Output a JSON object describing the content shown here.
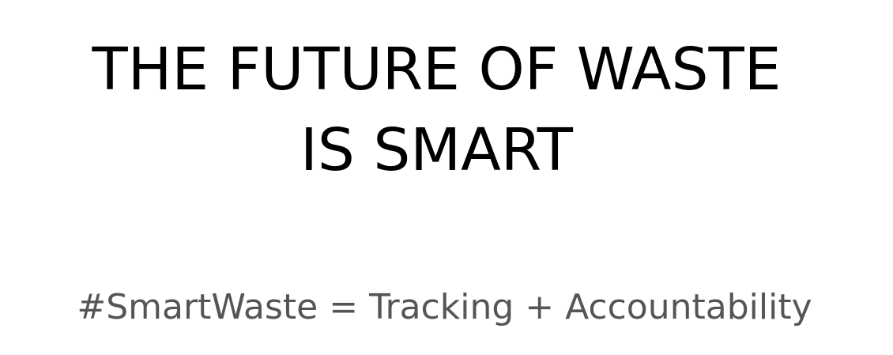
{
  "hero": {
    "headline_line_1": "THE FUTURE OF WASTE",
    "headline_line_2": "IS SMART",
    "tagline": "#SmartWaste = Tracking + Accountability"
  },
  "colors": {
    "background": "#ffffff",
    "headline": "#000000",
    "tagline": "#555555"
  }
}
